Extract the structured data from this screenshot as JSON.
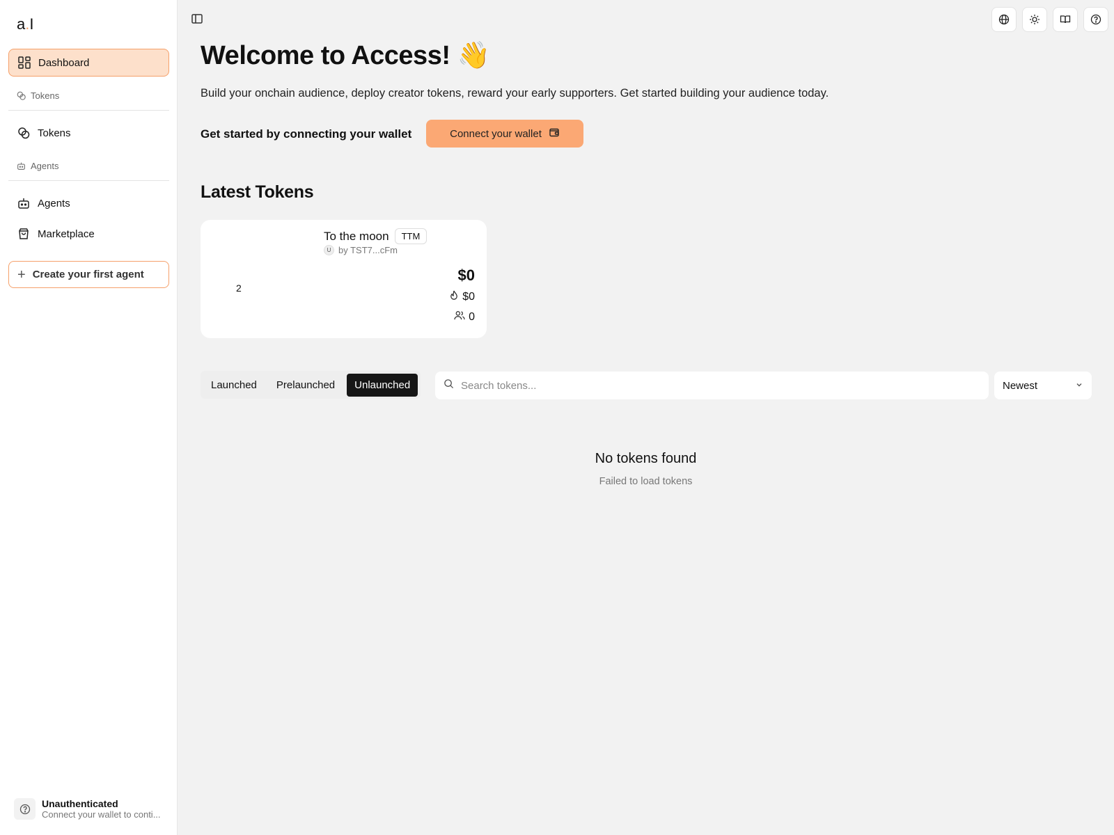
{
  "app": {
    "logo_text": "a",
    "logo_dot": ".",
    "logo_tail": "I"
  },
  "sidebar": {
    "items": [
      {
        "label": "Dashboard",
        "icon": "dashboard-icon",
        "active": true
      },
      {
        "label": "Tokens",
        "icon": "coins-icon"
      },
      {
        "label": "Agents",
        "icon": "bot-icon"
      },
      {
        "label": "Marketplace",
        "icon": "shopping-bag-icon"
      }
    ],
    "section_tokens": "Tokens",
    "section_agents": "Agents",
    "create_label": "Create your first agent",
    "auth_title": "Unauthenticated",
    "auth_subtitle": "Connect your wallet to conti..."
  },
  "header": {
    "icons": [
      "globe-icon",
      "sun-icon",
      "book-icon",
      "help-icon"
    ]
  },
  "main": {
    "welcome": "Welcome to Access! 👋",
    "subtitle": "Build your onchain audience, deploy creator tokens, reward your early supporters. Get started building your audience today.",
    "cta_text": "Get started by connecting your wallet",
    "connect_label": "Connect your wallet",
    "latest_title": "Latest Tokens",
    "token_card": {
      "image_alt": "2",
      "name": "To the moon",
      "symbol": "TTM",
      "avatar": "U",
      "creator": "by TST7...cFm",
      "price": "$0",
      "volume": "$0",
      "holders": "0"
    },
    "tabs": [
      {
        "label": "Launched"
      },
      {
        "label": "Prelaunched"
      },
      {
        "label": "Unlaunched",
        "active": true
      }
    ],
    "search_placeholder": "Search tokens...",
    "sort_value": "Newest",
    "empty_title": "No tokens found",
    "empty_subtitle": "Failed to load tokens"
  },
  "colors": {
    "accent": "#fba874",
    "active_bg": "#fde0cb",
    "dark_tab": "#161616"
  }
}
